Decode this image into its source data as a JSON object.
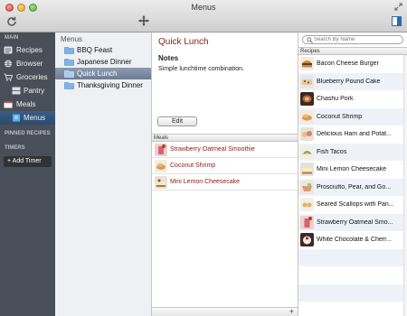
{
  "window": {
    "title": "Menus"
  },
  "sidebar": {
    "main_header": "MAIN",
    "items": [
      {
        "label": "Recipes",
        "icon": "recipes-icon"
      },
      {
        "label": "Browser",
        "icon": "globe-icon"
      },
      {
        "label": "Groceries",
        "icon": "cart-icon"
      },
      {
        "label": "Pantry",
        "icon": "pantry-icon"
      },
      {
        "label": "Meals",
        "icon": "calendar-icon"
      },
      {
        "label": "Menus",
        "icon": "menu-book-icon"
      }
    ],
    "pinned_header": "PINNED RECIPES",
    "timers_header": "TIMERS",
    "add_timer_label": "+ Add Timer"
  },
  "menus": {
    "header": "Menus",
    "items": [
      "BBQ Feast",
      "Japanese Dinner",
      "Quick Lunch",
      "Thanksgiving Dinner"
    ],
    "selected": "Quick Lunch"
  },
  "detail": {
    "title": "Quick Lunch",
    "notes_label": "Notes",
    "notes_text": "Simple lunchtime combination.",
    "edit_label": "Edit",
    "meals_header": "Meals",
    "meals": [
      "Strawberry Oatmeal Smoothie",
      "Coconut Shrimp",
      "Mini Lemon Cheesecake"
    ],
    "add_symbol": "+"
  },
  "recipes": {
    "search_placeholder": "Search By Name",
    "header": "Recipes",
    "items": [
      "Bacon Cheese Burger",
      "Blueberry Pound Cake",
      "Chashu Pork",
      "Coconut Shrimp",
      "Delicious Ham and Potat...",
      "Fish Tacos",
      "Mini Lemon Cheesecake",
      "Prosciutto, Pear, and Go...",
      "Seared Scallops with Pan...",
      "Strawberry Oatmeal Smo...",
      "White Chocolate & Cherr..."
    ]
  },
  "colors": {
    "accent_red": "#8b1a14",
    "sidebar_bg": "#484f58",
    "sidebar_selected": "#2c4a6c",
    "menu_selected": "#7a879c"
  }
}
